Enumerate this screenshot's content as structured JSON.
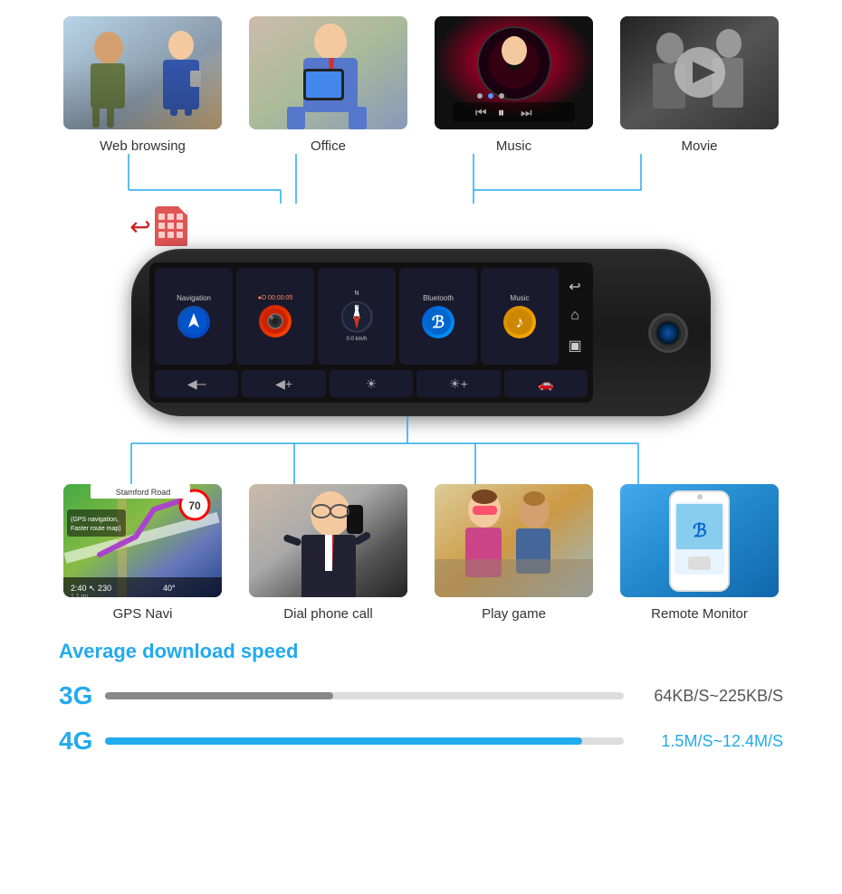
{
  "features_top": [
    {
      "id": "web",
      "label": "Web browsing",
      "thumb_class": "thumb-web"
    },
    {
      "id": "office",
      "label": "Office",
      "thumb_class": "thumb-office"
    },
    {
      "id": "music",
      "label": "Music",
      "thumb_class": "thumb-music"
    },
    {
      "id": "movie",
      "label": "Movie",
      "thumb_class": "thumb-movie"
    }
  ],
  "features_bottom": [
    {
      "id": "navi",
      "label": "GPS Navi",
      "thumb_class": "thumb-navi"
    },
    {
      "id": "dial",
      "label": "Dial phone call",
      "thumb_class": "thumb-dial"
    },
    {
      "id": "game",
      "label": "Play game",
      "thumb_class": "thumb-game"
    },
    {
      "id": "remote",
      "label": "Remote Monitor",
      "thumb_class": "thumb-remote"
    }
  ],
  "screen_buttons": [
    {
      "id": "navigation",
      "label": "Navigation",
      "icon_class": "btn-nav",
      "icon": "🧭"
    },
    {
      "id": "camera",
      "label": "●D 00:00:05",
      "icon_class": "btn-cam",
      "icon": "📷"
    },
    {
      "id": "compass",
      "label": "N  0.0 km/h",
      "icon_class": "btn-compass",
      "icon": "▲"
    },
    {
      "id": "bluetooth",
      "label": "Bluetooth",
      "icon_class": "btn-bt",
      "icon": "⚡"
    },
    {
      "id": "music",
      "label": "Music",
      "icon_class": "btn-music-icon",
      "icon": "♪"
    }
  ],
  "nav_icons": [
    "↩",
    "⌂",
    "▣"
  ],
  "bottom_buttons": [
    "◀─",
    "◀+",
    "☀",
    "☀+",
    "🚗"
  ],
  "speed_section": {
    "title": "Average download speed",
    "rows": [
      {
        "label": "3G",
        "fill_pct": 44,
        "value": "64KB/S~225KB/S",
        "is_4g": false
      },
      {
        "label": "4G",
        "fill_pct": 92,
        "value": "1.5M/S~12.4M/S",
        "is_4g": true
      }
    ]
  }
}
